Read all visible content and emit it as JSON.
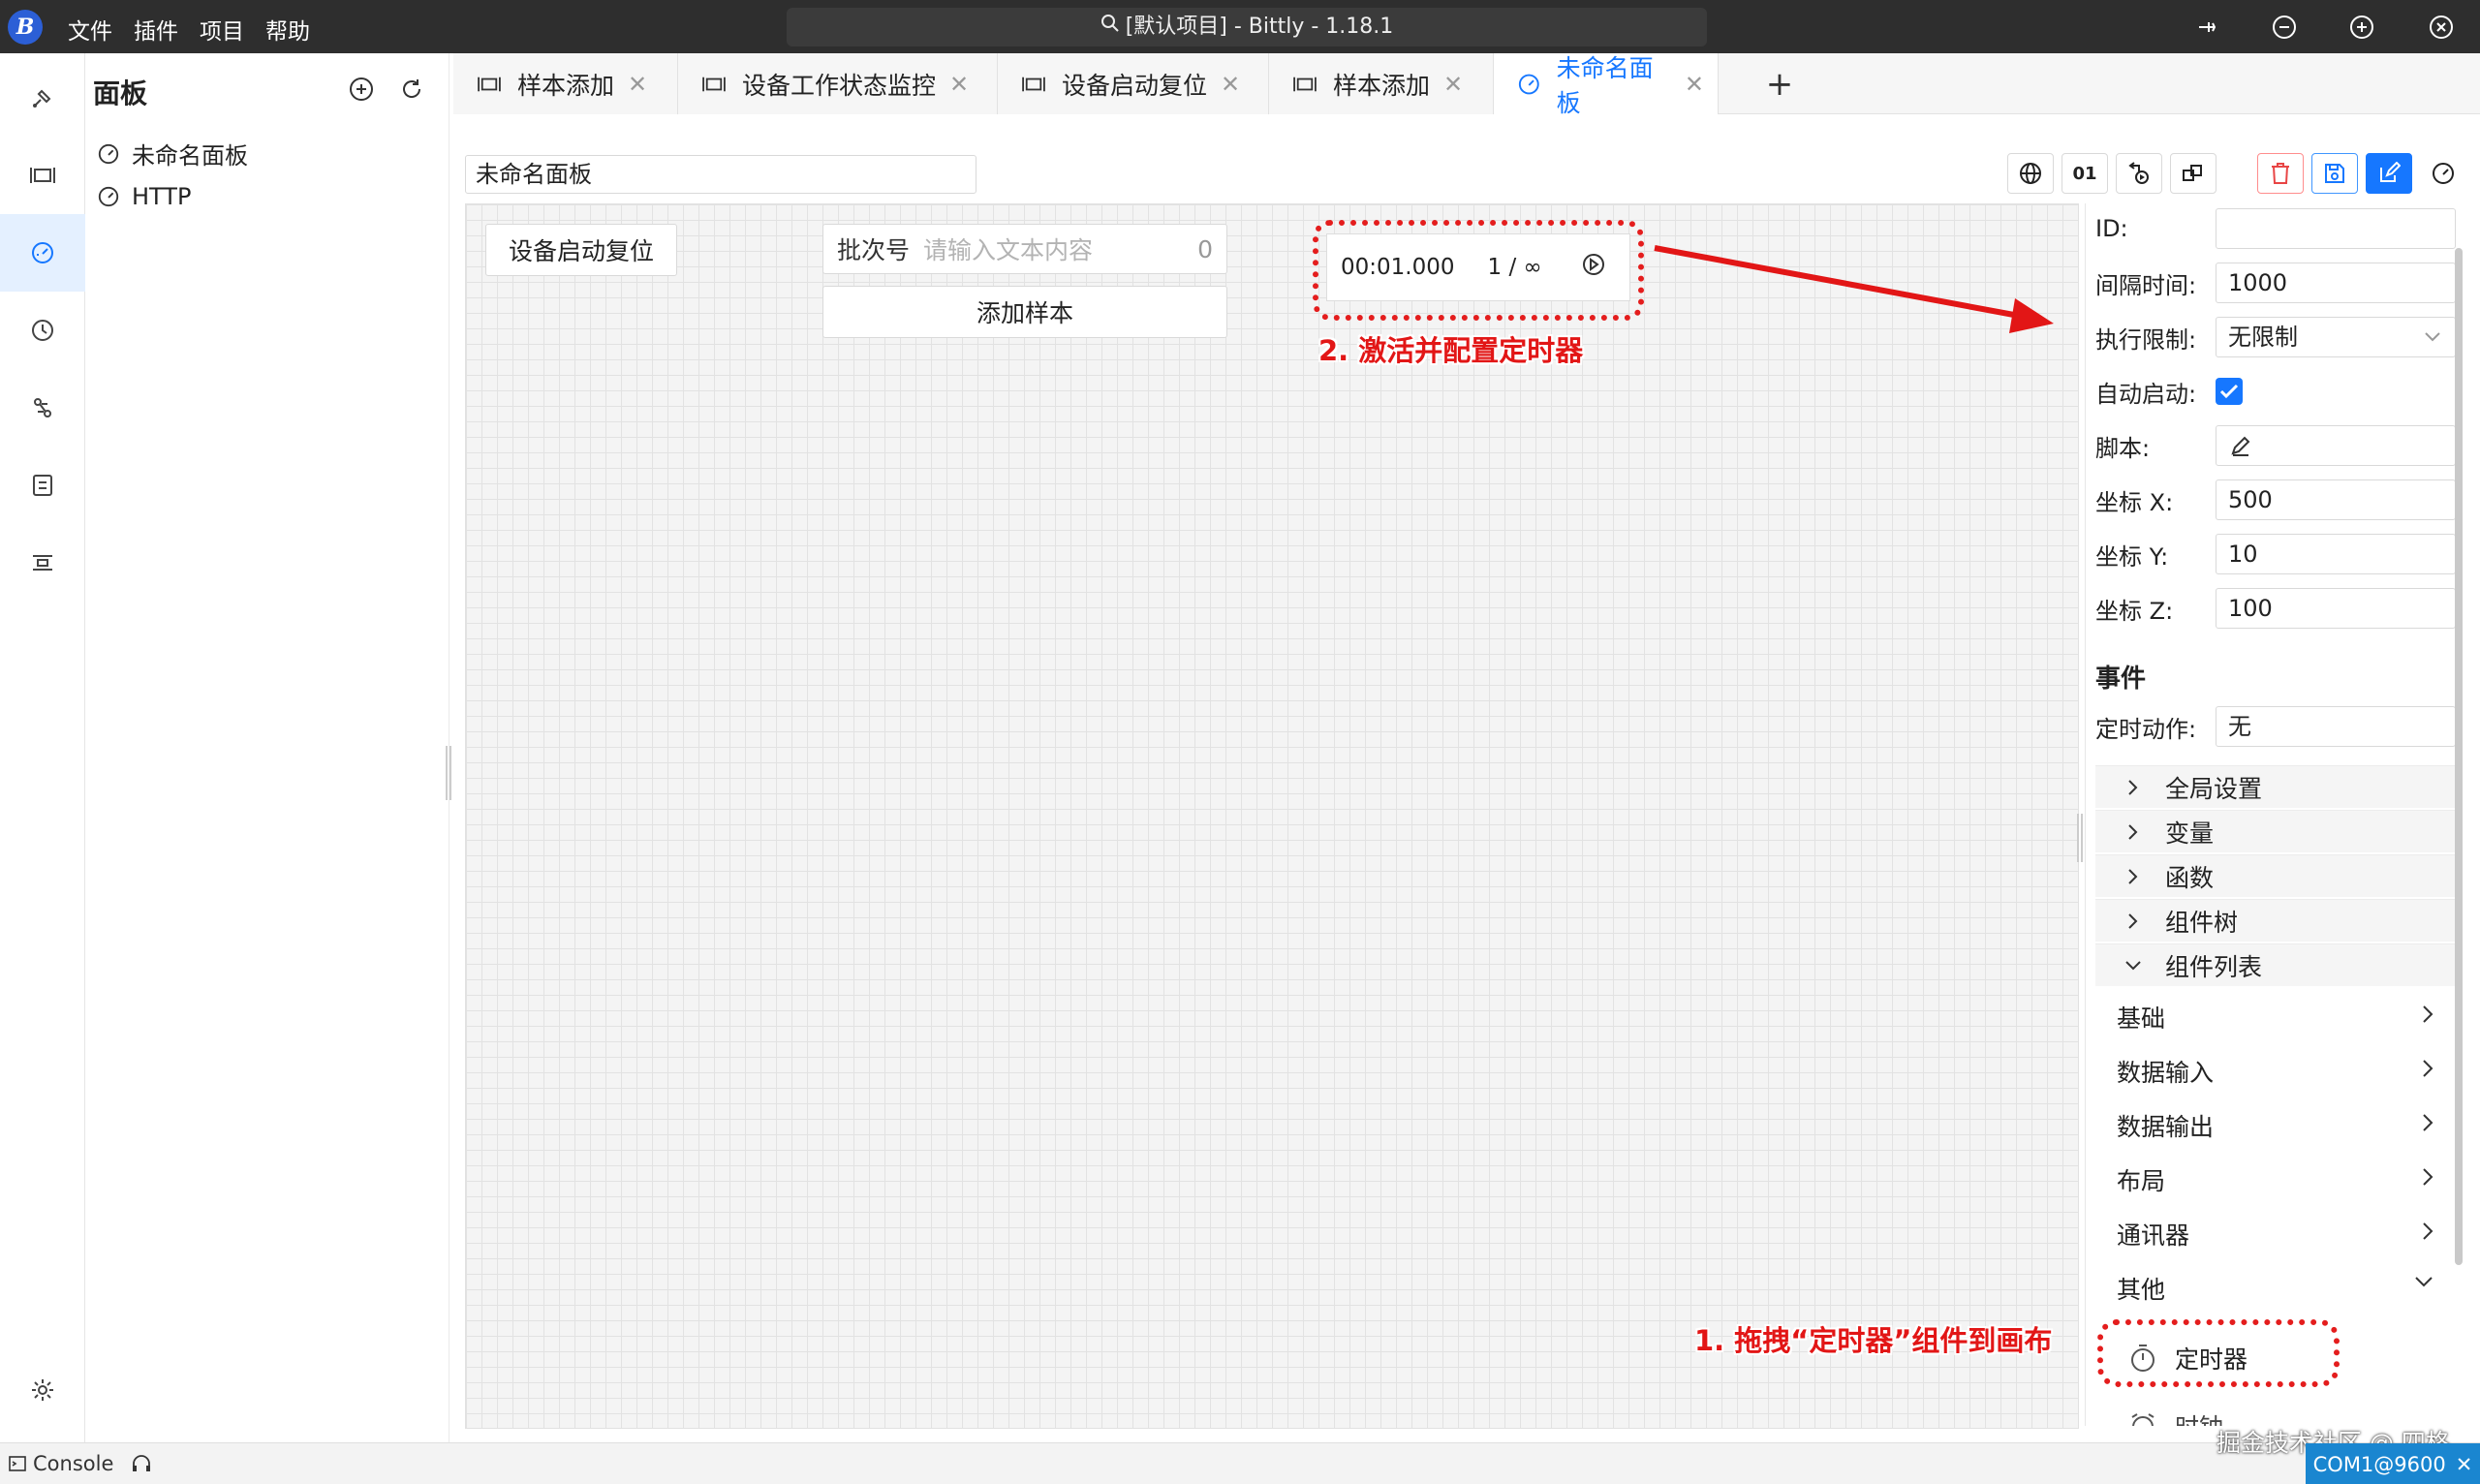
{
  "app": {
    "logo_letter": "B",
    "menu": [
      "文件",
      "插件",
      "项目",
      "帮助"
    ],
    "title": "[默认项目] - Bittly - 1.18.1"
  },
  "sidebar": {
    "title": "面板",
    "items": [
      {
        "label": "未命名面板",
        "icon": "gauge-icon"
      },
      {
        "label": "HTTP",
        "icon": "gauge-icon"
      }
    ]
  },
  "tabs": [
    {
      "label": "样本添加",
      "icon": "frame-icon",
      "active": false
    },
    {
      "label": "设备工作状态监控",
      "icon": "frame-icon",
      "active": false
    },
    {
      "label": "设备启动复位",
      "icon": "frame-icon",
      "active": false
    },
    {
      "label": "样本添加",
      "icon": "frame-icon",
      "active": false
    },
    {
      "label": "未命名面板",
      "icon": "gauge-icon",
      "active": true
    }
  ],
  "tab_add_label": "+",
  "editor": {
    "panel_name": "未命名面板",
    "toolbar_text_button": "01"
  },
  "canvas": {
    "reset_button": "设备启动复位",
    "batch_label": "批次号",
    "batch_placeholder": "请输入文本内容",
    "batch_count": "0",
    "add_sample_button": "添加样本",
    "timer_time": "00:01.000",
    "timer_count": "1 / ∞",
    "annotation_configure": "2. 激活并配置定时器",
    "annotation_drag": "1. 拖拽“定时器”组件到画布"
  },
  "props": {
    "id_label": "ID:",
    "id_value": "",
    "interval_label": "间隔时间:",
    "interval_value": "1000",
    "limit_label": "执行限制:",
    "limit_value": "无限制",
    "autostart_label": "自动启动:",
    "autostart_checked": true,
    "script_label": "脚本:",
    "x_label": "坐标 X:",
    "x_value": "500",
    "y_label": "坐标 Y:",
    "y_value": "10",
    "z_label": "坐标 Z:",
    "z_value": "100",
    "events_title": "事件",
    "timer_action_label": "定时动作:",
    "timer_action_value": "无",
    "sections": [
      "全局设置",
      "变量",
      "函数",
      "组件树",
      "组件列表"
    ],
    "categories": [
      "基础",
      "数据输入",
      "数据输出",
      "布局",
      "通讯器",
      "其他"
    ],
    "timer_component": "定时器",
    "clock_component": "时钟"
  },
  "status": {
    "console_label": "Console",
    "watermark": "掘金技术社区 @ 四格",
    "com_port": "COM1@9600"
  },
  "colors": {
    "accent": "#1677ff",
    "annotation": "#e21616",
    "titlebar": "#2e2e2e",
    "status_badge": "#1a86d0"
  }
}
